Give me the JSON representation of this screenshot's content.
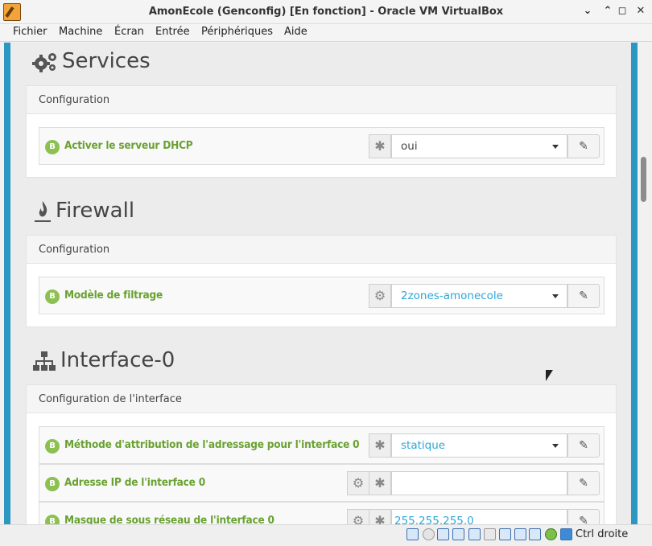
{
  "window": {
    "title": "AmonEcole (Genconfig) [En fonction] - Oracle VM VirtualBox",
    "controls": {
      "minimize": "✕",
      "restore": "▭",
      "maximize": "□",
      "close": "✕"
    }
  },
  "menu": {
    "items": [
      "Fichier",
      "Machine",
      "Écran",
      "Entrée",
      "Périphériques",
      "Aide"
    ]
  },
  "sections": {
    "services": {
      "title": "Services",
      "panel_title": "Configuration",
      "rows": [
        {
          "badge": "B",
          "label": "Activer le serveur DHCP",
          "value": "oui"
        }
      ]
    },
    "firewall": {
      "title": "Firewall",
      "panel_title": "Configuration",
      "rows": [
        {
          "badge": "B",
          "label": "Modèle de filtrage",
          "value": "2zones-amonecole"
        }
      ]
    },
    "interface0": {
      "title": "Interface-0",
      "panel_title": "Configuration de l'interface",
      "rows": [
        {
          "badge": "B",
          "label": "Méthode d'attribution de l'adressage pour l'interface 0",
          "value": "statique"
        },
        {
          "badge": "B",
          "label": "Adresse IP de l'interface 0",
          "value": ""
        },
        {
          "badge": "B",
          "label": "Masque de sous réseau de l'interface 0",
          "value": "255.255.255.0"
        }
      ]
    }
  },
  "statusbar": {
    "host_key": "Ctrl droite"
  },
  "colors": {
    "accent_stripe": "#2c98c2",
    "label_green": "#6aa132",
    "badge_green": "#8cc152",
    "value_blue": "#2ea7d8"
  },
  "icons": {
    "services": "gears-icon",
    "firewall": "flame-icon",
    "interface": "sitemap-icon",
    "required": "asterisk-icon",
    "variable": "gear-icon",
    "edit": "edit-icon"
  }
}
